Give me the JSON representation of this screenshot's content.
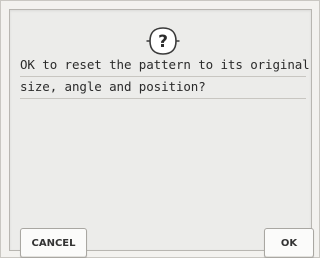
{
  "dialog": {
    "icon": "question-mark-icon",
    "message_lines": [
      "OK to reset the pattern to its original",
      "size, angle and position?"
    ],
    "cancel_label": "CANCEL",
    "ok_label": "OK"
  },
  "colors": {
    "background": "#ececea",
    "text": "#2b2b2b",
    "button_face": "#fbfbfa"
  }
}
